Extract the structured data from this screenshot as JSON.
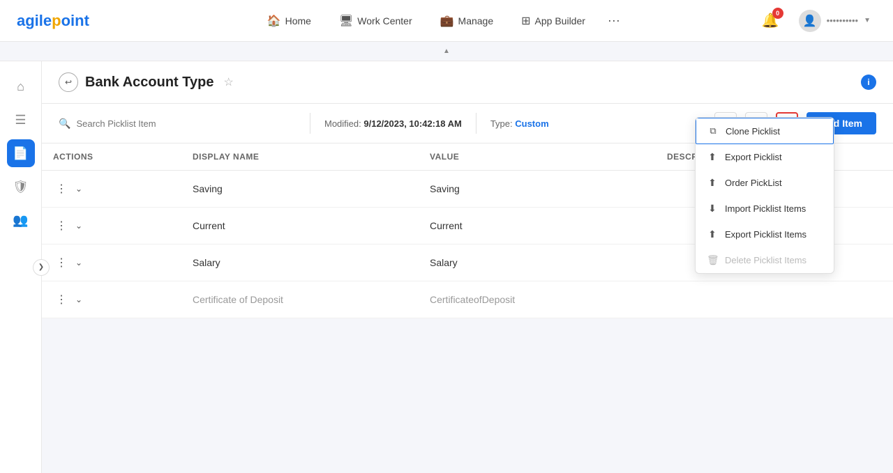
{
  "logo": {
    "text": "agilepoint"
  },
  "topnav": {
    "items": [
      {
        "id": "home",
        "label": "Home",
        "icon": "🏠"
      },
      {
        "id": "workcenter",
        "label": "Work Center",
        "icon": "🖥"
      },
      {
        "id": "manage",
        "label": "Manage",
        "icon": "💼"
      },
      {
        "id": "appbuilder",
        "label": "App Builder",
        "icon": "⊞"
      }
    ],
    "more_icon": "···",
    "notification_count": "0",
    "user_name": "••••••••••"
  },
  "page": {
    "title": "Bank Account Type",
    "modified_label": "Modified:",
    "modified_value": "9/12/2023, 10:42:18 AM",
    "type_label": "Type:",
    "type_value": "Custom",
    "search_placeholder": "Search Picklist Item",
    "add_item_label": "Add Item"
  },
  "table": {
    "columns": [
      "ACTIONS",
      "DISPLAY NAME",
      "VALUE",
      "DESCRIPTION"
    ],
    "rows": [
      {
        "display_name": "Saving",
        "value": "Saving",
        "description": ""
      },
      {
        "display_name": "Current",
        "value": "Current",
        "description": ""
      },
      {
        "display_name": "Salary",
        "value": "Salary",
        "description": ""
      },
      {
        "display_name": "Certificate of Deposit",
        "value": "CertificateofDeposit",
        "description": ""
      }
    ]
  },
  "dropdown": {
    "items": [
      {
        "id": "clone",
        "label": "Clone Picklist",
        "icon": "⧉",
        "state": "active"
      },
      {
        "id": "export",
        "label": "Export Picklist",
        "icon": "↑",
        "state": "normal"
      },
      {
        "id": "order",
        "label": "Order PickList",
        "icon": "↑",
        "state": "normal"
      },
      {
        "id": "import-items",
        "label": "Import Picklist Items",
        "icon": "↓",
        "state": "normal"
      },
      {
        "id": "export-items",
        "label": "Export Picklist Items",
        "icon": "↑",
        "state": "normal"
      },
      {
        "id": "delete-items",
        "label": "Delete Picklist Items",
        "icon": "🗑",
        "state": "disabled"
      }
    ]
  },
  "sidebar": {
    "icons": [
      {
        "id": "home",
        "icon": "⌂",
        "active": false
      },
      {
        "id": "list",
        "icon": "☰",
        "active": false
      },
      {
        "id": "document",
        "icon": "📄",
        "active": true
      },
      {
        "id": "shield",
        "icon": "🛡",
        "active": false
      },
      {
        "id": "users",
        "icon": "👥",
        "active": false
      }
    ]
  }
}
